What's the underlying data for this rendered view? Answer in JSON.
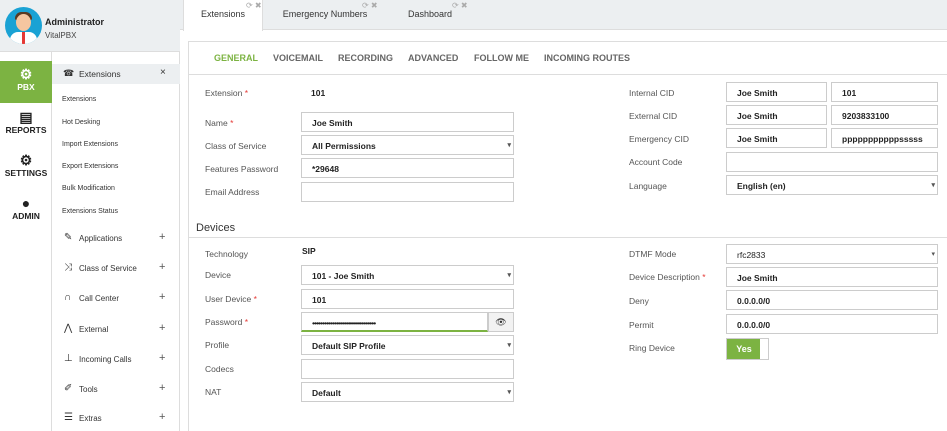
{
  "user": {
    "name": "Administrator",
    "role": "VitalPBX"
  },
  "nav": [
    {
      "label": "PBX",
      "icon": "gear-icon"
    },
    {
      "label": "REPORTS",
      "icon": "document-icon"
    },
    {
      "label": "SETTINGS",
      "icon": "gears-icon"
    },
    {
      "label": "ADMIN",
      "icon": "users-icon"
    }
  ],
  "submenu": {
    "header": "Extensions",
    "close": "×",
    "items": [
      "Extensions",
      "Hot Desking",
      "Import Extensions",
      "Export Extensions",
      "Bulk Modification",
      "Extensions Status"
    ],
    "groups": [
      "Applications",
      "Class of Service",
      "Call Center",
      "External",
      "Incoming Calls",
      "Tools",
      "Extras"
    ],
    "plus": "+"
  },
  "tabs": [
    "Extensions",
    "Emergency Numbers",
    "Dashboard"
  ],
  "tab_controls": "⟳ ✖",
  "subtabs": [
    "GENERAL",
    "VOICEMAIL",
    "RECORDING",
    "ADVANCED",
    "FOLLOW ME",
    "INCOMING ROUTES"
  ],
  "form": {
    "extension_label": "Extension",
    "extension_value": "101",
    "name_label": "Name",
    "name_value": "Joe Smith",
    "cos_label": "Class of Service",
    "cos_value": "All Permissions",
    "fpw_label": "Features Password",
    "fpw_value": "*29648",
    "email_label": "Email Address",
    "email_value": "",
    "icid_label": "Internal CID",
    "icid_name": "Joe Smith",
    "icid_num": "101",
    "ecid_label": "External CID",
    "ecid_name": "Joe Smith",
    "ecid_num": "9203833100",
    "emcid_label": "Emergency CID",
    "emcid_name": "Joe Smith",
    "emcid_num": "pppppppppppsssss",
    "acode_label": "Account Code",
    "acode_value": "",
    "lang_label": "Language",
    "lang_value": "English (en)"
  },
  "devices": {
    "title": "Devices",
    "tech_label": "Technology",
    "tech_value": "SIP",
    "device_label": "Device",
    "device_value": "101 - Joe Smith",
    "udev_label": "User Device",
    "udev_value": "101",
    "pw_label": "Password",
    "pw_value": "••••••••••••••••••••••••••••••••",
    "profile_label": "Profile",
    "profile_value": "Default SIP Profile",
    "codecs_label": "Codecs",
    "codecs_value": "",
    "nat_label": "NAT",
    "nat_value": "Default",
    "dtmf_label": "DTMF Mode",
    "dtmf_value": "rfc2833",
    "desc_label": "Device Description",
    "desc_value": "Joe Smith",
    "deny_label": "Deny",
    "deny_value": "0.0.0.0/0",
    "permit_label": "Permit",
    "permit_value": "0.0.0.0/0",
    "ring_label": "Ring Device",
    "ring_value": "Yes"
  },
  "req": "*",
  "glyphs": {
    "arrow": "▾",
    "eye": "👁"
  },
  "colors": {
    "accent": "#7cb342",
    "required": "#e53935"
  }
}
